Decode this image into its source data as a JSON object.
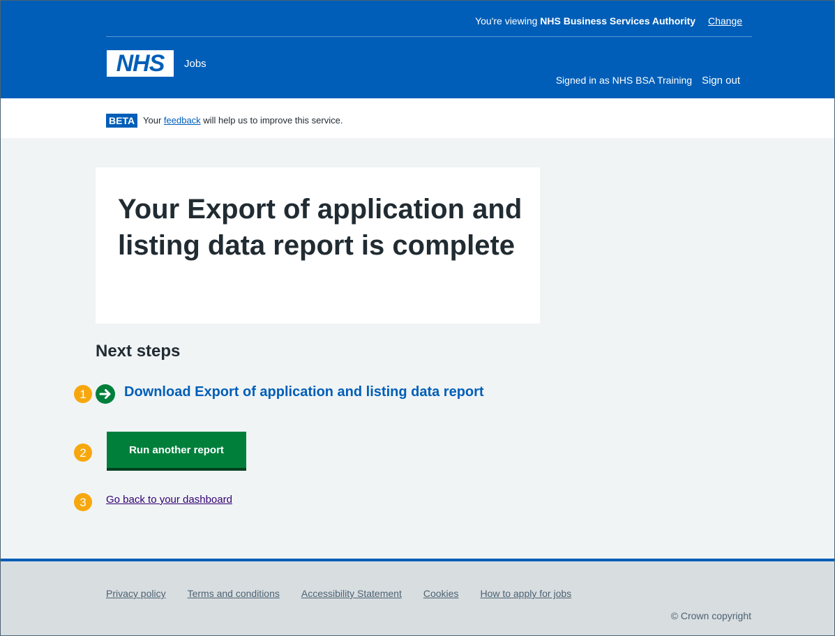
{
  "header": {
    "org_prefix": "You're viewing",
    "org_name": "NHS Business Services Authority",
    "change_label": "Change",
    "logo_text": "NHS",
    "service_name": "Jobs",
    "signed_in": "Signed in as NHS BSA Training",
    "sign_out": "Sign out"
  },
  "beta": {
    "tag": "BETA",
    "text_before": "Your",
    "feedback_link": "feedback",
    "text_after": "will help us to improve this service."
  },
  "main": {
    "title": "Your Export of application and listing data report is complete",
    "next_steps_heading": "Next steps",
    "download_link": "Download Export of application and listing data report",
    "run_another_button": "Run another report",
    "dashboard_link": "Go back to your dashboard"
  },
  "annotations": [
    "1",
    "2",
    "3"
  ],
  "footer": {
    "links": [
      "Privacy policy",
      "Terms and conditions",
      "Accessibility Statement",
      "Cookies",
      "How to apply for jobs"
    ],
    "copyright": "© Crown copyright"
  },
  "colors": {
    "nhs_blue": "#005eb8",
    "button_green": "#007f3b",
    "annotation_orange": "#f7a70e",
    "visited_purple": "#330072"
  }
}
